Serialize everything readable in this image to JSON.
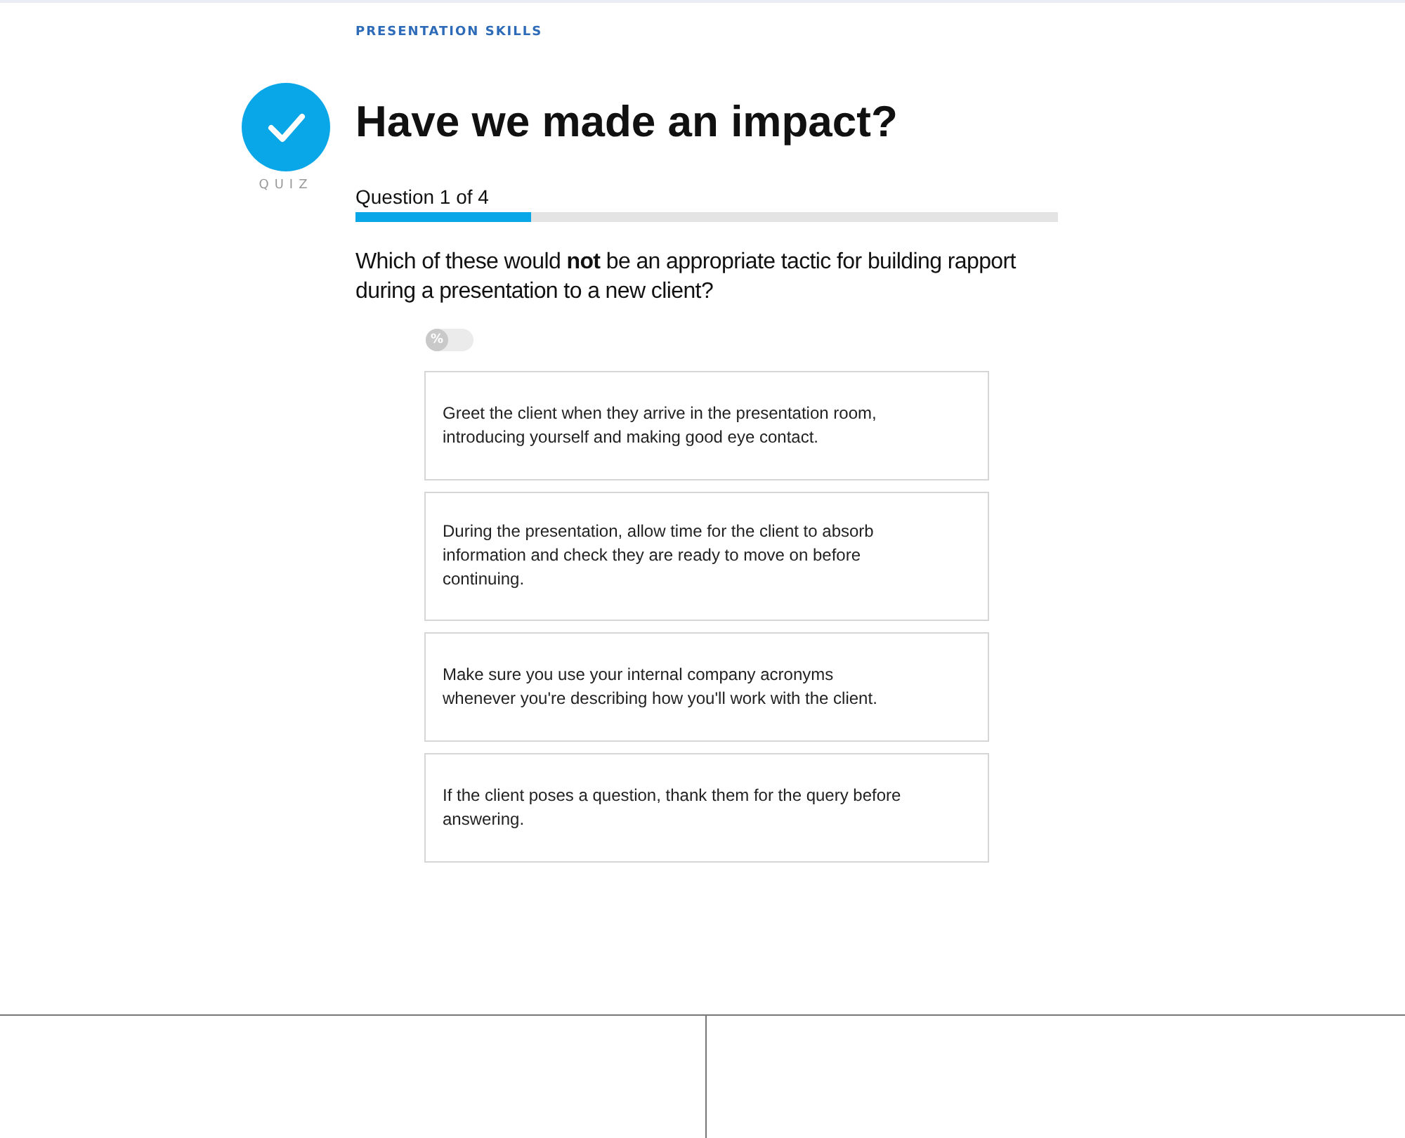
{
  "course": "PRESENTATION SKILLS",
  "badge": {
    "label": "QUIZ"
  },
  "title": "Have we made an impact?",
  "progress": {
    "label": "Question 1 of 4",
    "level": 0.25
  },
  "question": "Which of these would **not** be an appropriate tactic for building rapport during a presentation to a new client?",
  "percent_toggle": {
    "label": "%",
    "on": false
  },
  "answers": [
    {
      "text": "Greet the client when they arrive in the presentation room, introducing yourself and making good eye contact.",
      "selected": false
    },
    {
      "text": "During the presentation, allow time for the client to absorb information and check they are ready to move on before continuing.",
      "selected": false
    },
    {
      "text": "Make sure you use your internal company acronyms whenever you're describing how you'll work with the client.",
      "selected": false
    },
    {
      "text": "If the client poses a question, thank them for the query before answering.",
      "selected": false
    }
  ]
}
